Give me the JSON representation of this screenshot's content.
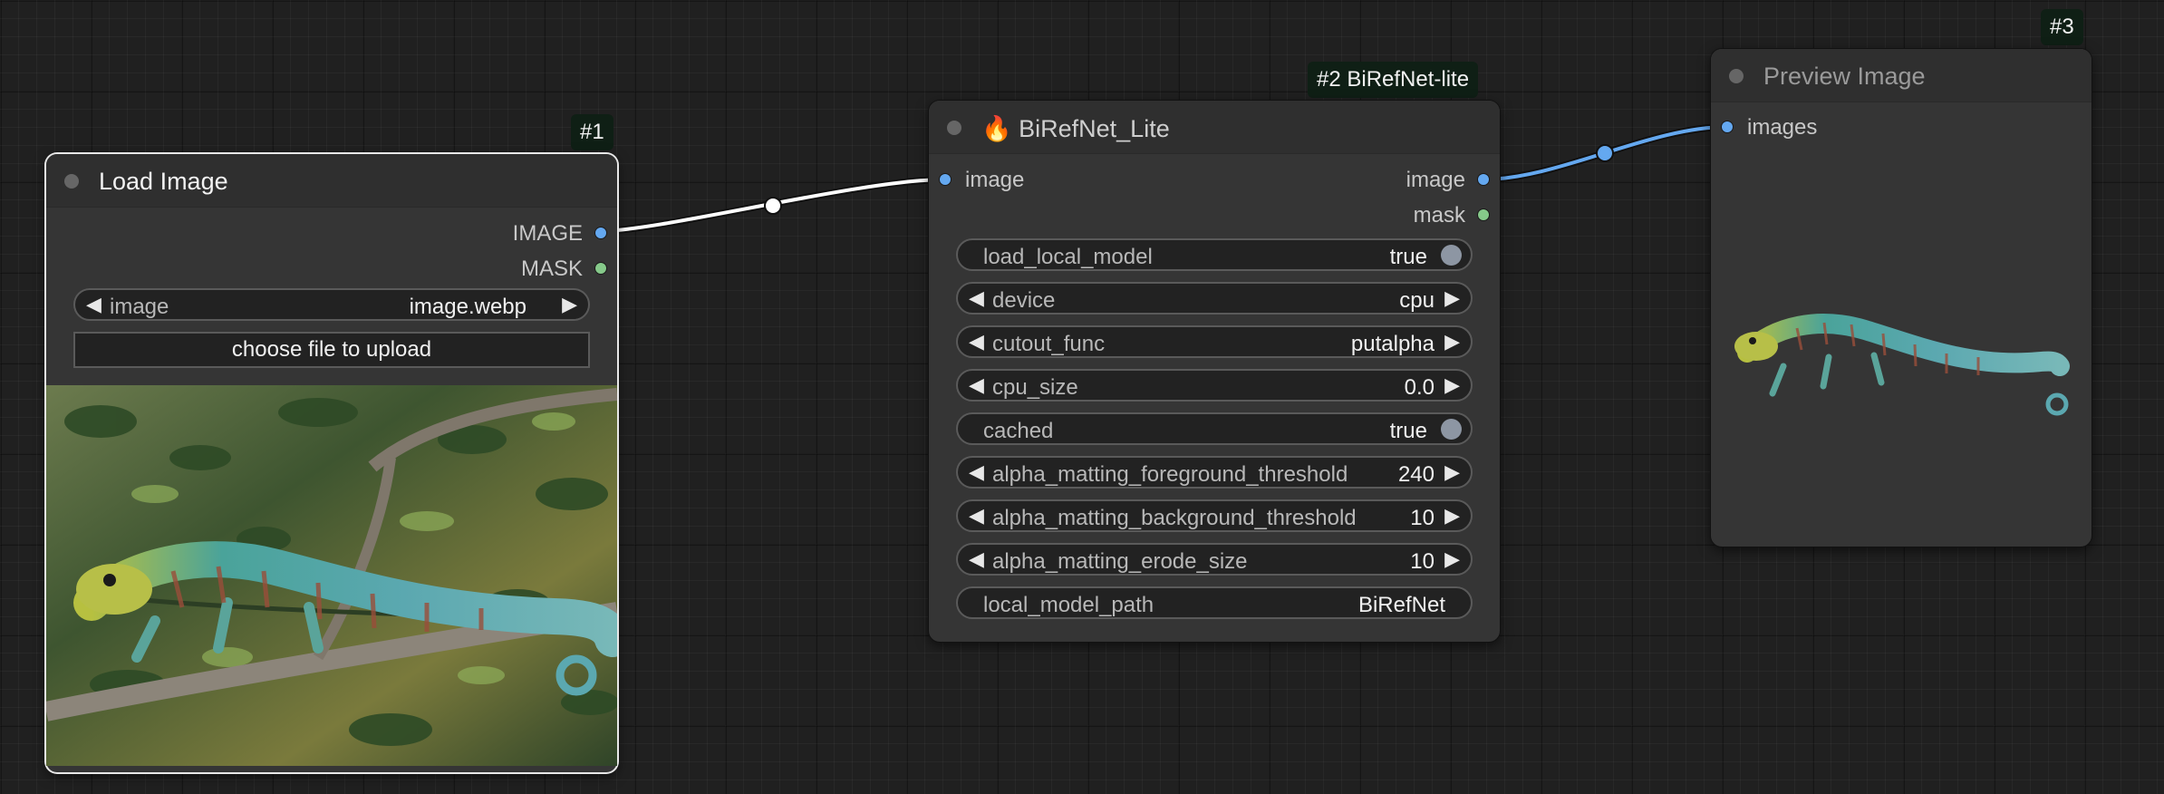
{
  "nodes": {
    "load_image": {
      "badge": "#1",
      "title": "Load Image",
      "outputs": [
        "IMAGE",
        "MASK"
      ],
      "image_widget": {
        "label": "image",
        "value": "image.webp"
      },
      "upload_button": "choose file to upload",
      "preview": "chameleon photo on branch"
    },
    "birefnet": {
      "badge": "#2 BiRefNet-lite",
      "title": "🔥 BiRefNet_Lite",
      "input": "image",
      "outputs": [
        "image",
        "mask"
      ],
      "widgets": [
        {
          "label": "load_local_model",
          "value": "true",
          "kind": "toggle"
        },
        {
          "label": "device",
          "value": "cpu",
          "kind": "combo"
        },
        {
          "label": "cutout_func",
          "value": "putalpha",
          "kind": "combo"
        },
        {
          "label": "cpu_size",
          "value": "0.0",
          "kind": "number"
        },
        {
          "label": "cached",
          "value": "true",
          "kind": "toggle"
        },
        {
          "label": "alpha_matting_foreground_threshold",
          "value": "240",
          "kind": "number"
        },
        {
          "label": "alpha_matting_background_threshold",
          "value": "10",
          "kind": "number"
        },
        {
          "label": "alpha_matting_erode_size",
          "value": "10",
          "kind": "number"
        },
        {
          "label": "local_model_path",
          "value": "BiRefNet",
          "kind": "text"
        }
      ]
    },
    "preview_image": {
      "badge": "#3",
      "title": "Preview Image",
      "input": "images",
      "preview": "cutout chameleon"
    }
  },
  "colors": {
    "image_link": "#ffffff",
    "mask_link": "#64a8f0",
    "image_slot": "#64a8f0",
    "mask_slot": "#86c98a"
  }
}
